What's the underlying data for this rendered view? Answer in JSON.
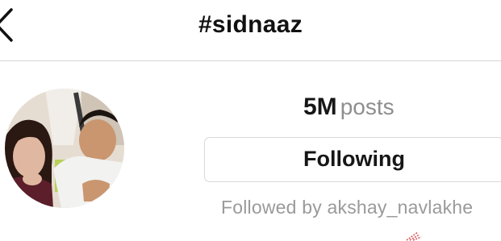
{
  "header": {
    "title": "#sidnaaz",
    "back_icon": "chevron-left-icon"
  },
  "profile": {
    "post_count": "5M",
    "post_label": "posts",
    "follow_button_label": "Following",
    "followed_by_text": "Followed by akshay_navlakhe"
  },
  "colors": {
    "text": "#161616",
    "muted_text": "#8e8e8e",
    "border": "#d8d8d8"
  }
}
